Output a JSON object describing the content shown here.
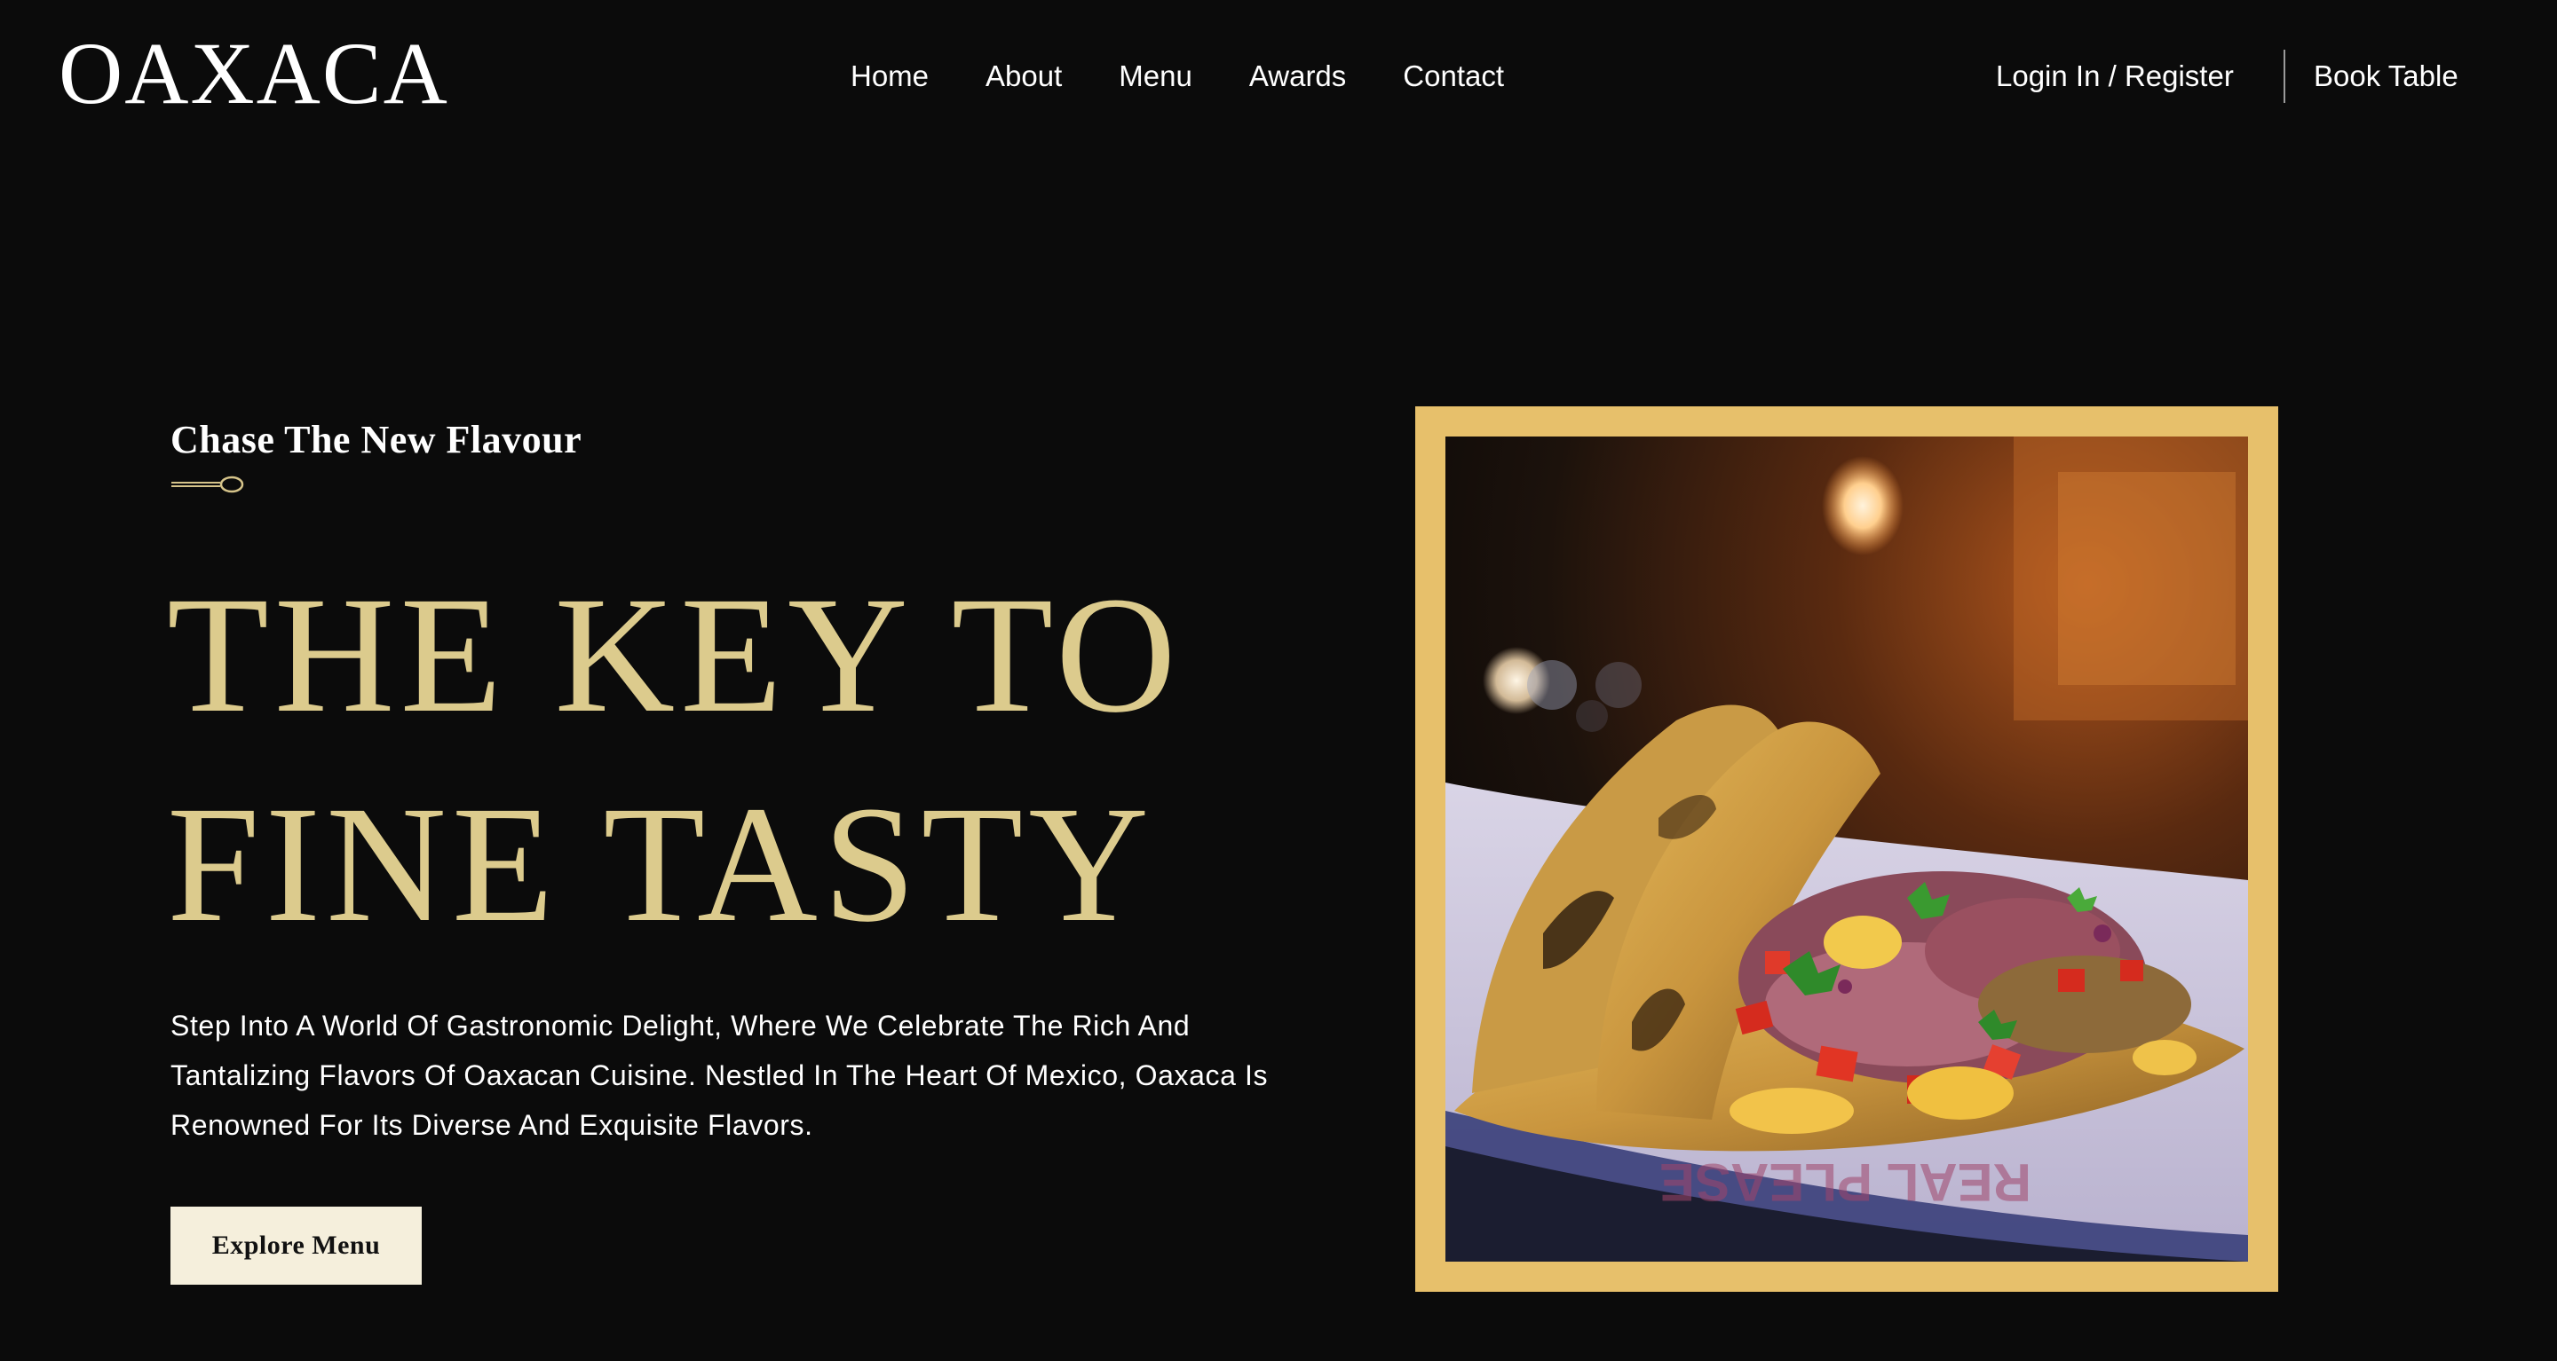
{
  "brand": {
    "logo": "OAXACA"
  },
  "nav": {
    "items": [
      "Home",
      "About",
      "Menu",
      "Awards",
      "Contact"
    ],
    "login_label": "Login In / Register",
    "book_label": "Book Table"
  },
  "hero": {
    "eyebrow": "Chase The New Flavour",
    "headline_line1": "THE KEY TO",
    "headline_line2": "FINE TASTY",
    "description": "Step Into A World Of Gastronomic Delight, Where We Celebrate The Rich And Tantalizing Flavors Of Oaxacan Cuisine. Nestled In The Heart Of Mexico, Oaxaca Is Renowned For Its Diverse And Exquisite Flavors.",
    "cta_label": "Explore Menu",
    "image_icon": "taco-photo"
  },
  "colors": {
    "background": "#0b0b0b",
    "headline_gold": "#dccb8d",
    "frame_gold": "#e7c06b",
    "button_cream": "#f5efdc"
  }
}
